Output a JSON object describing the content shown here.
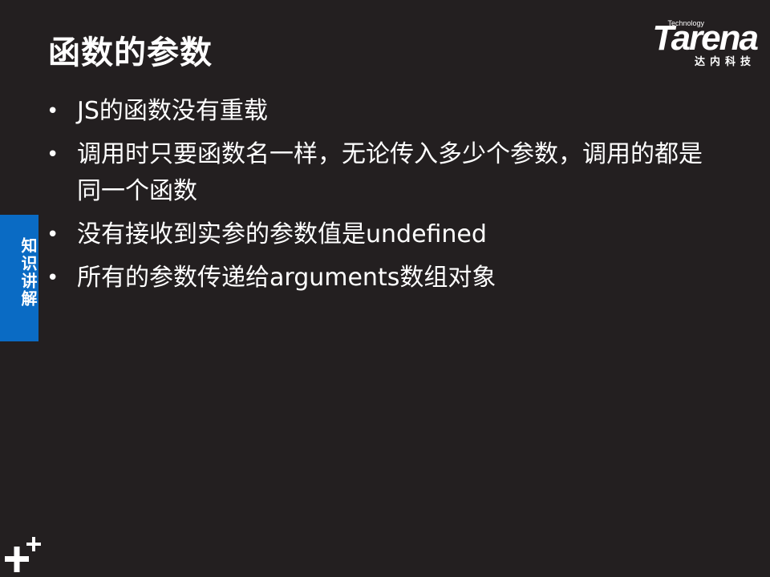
{
  "slide": {
    "title": "函数的参数",
    "logo": {
      "tagline": "Technology",
      "wordmark": "Tarena",
      "chinese": "达内科技"
    },
    "side_tab": "知识讲解",
    "bullets": [
      {
        "text": "JS的函数没有重载"
      },
      {
        "text": "调用时只要函数名一样，无论传入多少个参数，调用的都是同一个函数"
      },
      {
        "text": "没有接收到实参的参数值是undefined"
      },
      {
        "text": "所有的参数传递给arguments数组对象"
      }
    ],
    "bullet_symbol": "•",
    "colors": {
      "background": "#231f20",
      "text": "#ffffff",
      "side_tab": "#0a6bc4"
    }
  }
}
